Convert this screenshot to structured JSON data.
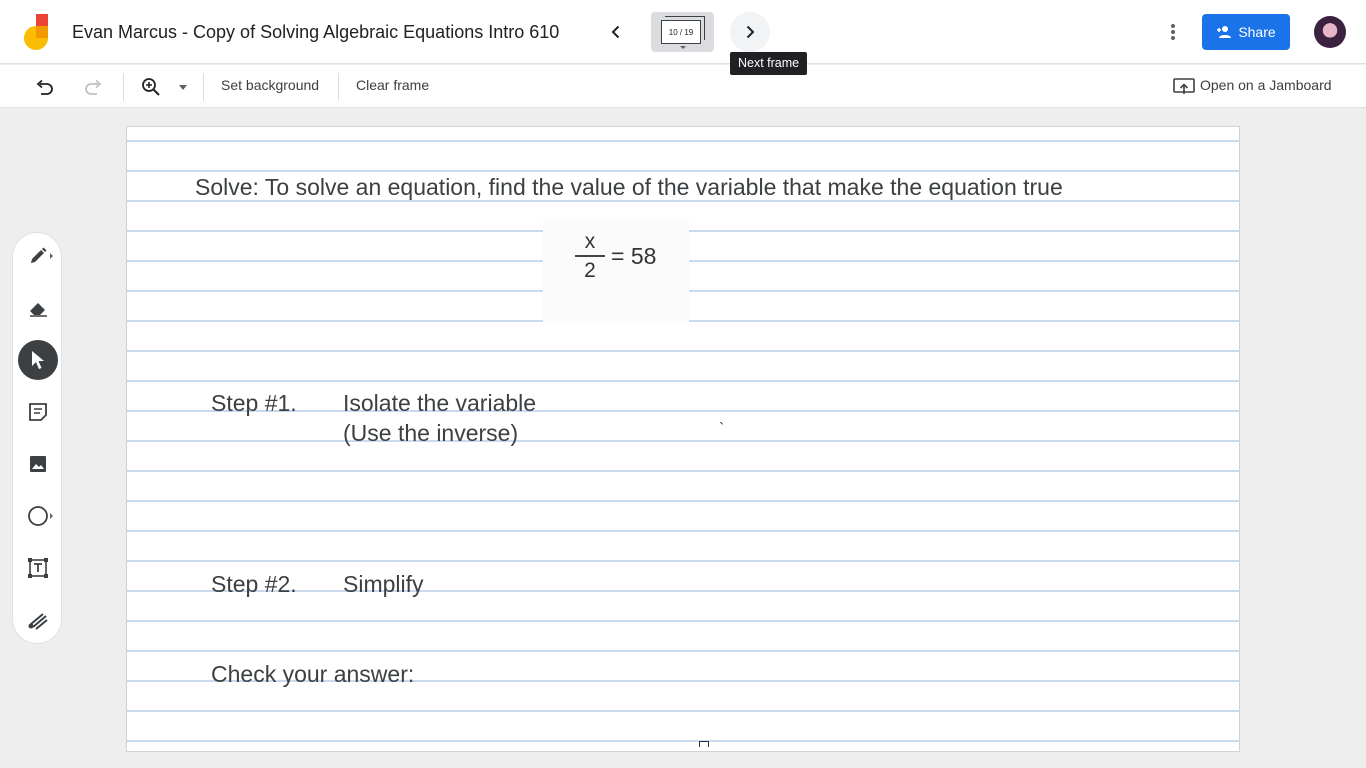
{
  "header": {
    "doc_title": "Evan Marcus - Copy of Solving Algebraic Equations Intro 610",
    "frame_indicator": "10 / 19",
    "tooltip": "Next frame",
    "share_label": "Share",
    "accent_color": "#1a73e8"
  },
  "toolbar": {
    "set_background": "Set background",
    "clear_frame": "Clear frame",
    "open_jamboard": "Open on a Jamboard"
  },
  "tools": [
    "pen",
    "eraser",
    "select",
    "sticky-note",
    "image",
    "circle",
    "text-box",
    "laser"
  ],
  "canvas": {
    "solve_line": "Solve:  To solve an equation, find the value of the variable that make the equation true",
    "equation": {
      "numerator": "x",
      "denominator": "2",
      "rest": "= 58"
    },
    "step1_label": "Step #1.",
    "step1_line1": "Isolate the variable",
    "step1_line2": "(Use the inverse)",
    "step2_label": "Step #2.",
    "step2_text": "Simplify",
    "check": "Check your answer:",
    "stray_mark": "`"
  }
}
